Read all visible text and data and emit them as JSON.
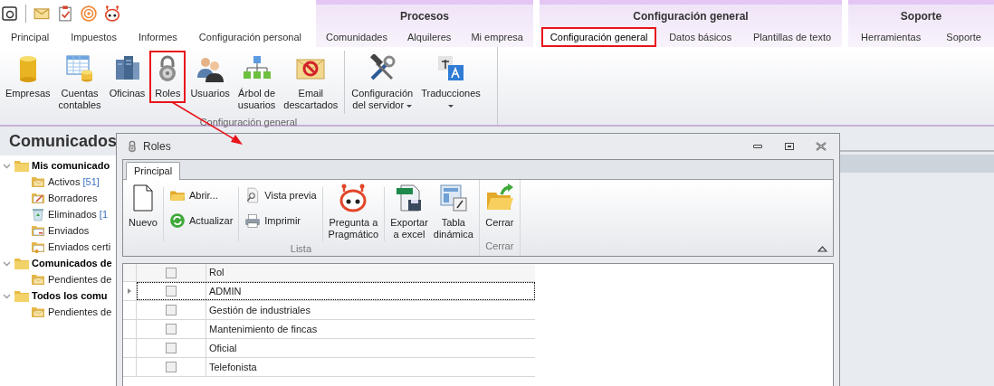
{
  "ribbon": {
    "tabs": [
      {
        "label": "Principal",
        "selected": false,
        "highlighted": false
      },
      {
        "label": "Impuestos",
        "selected": false,
        "highlighted": false
      },
      {
        "label": "Informes",
        "selected": false,
        "highlighted": false
      },
      {
        "label": "Configuración personal",
        "selected": false,
        "highlighted": false
      }
    ],
    "tab_groups": [
      {
        "title": "Procesos",
        "tabs": [
          {
            "label": "Comunidades",
            "selected": false,
            "highlighted": false
          },
          {
            "label": "Alquileres",
            "selected": false,
            "highlighted": false
          },
          {
            "label": "Mi empresa",
            "selected": false,
            "highlighted": false
          }
        ]
      },
      {
        "title": "Configuración general",
        "tabs": [
          {
            "label": "Configuración general",
            "selected": true,
            "highlighted": true
          },
          {
            "label": "Datos básicos",
            "selected": false,
            "highlighted": false
          },
          {
            "label": "Plantillas de texto",
            "selected": false,
            "highlighted": false
          }
        ]
      },
      {
        "title": "Soporte",
        "tabs": [
          {
            "label": "Herramientas",
            "selected": false,
            "highlighted": false
          },
          {
            "label": "Soporte",
            "selected": false,
            "highlighted": false
          }
        ]
      }
    ],
    "group": {
      "label": "Configuración general",
      "buttons": [
        {
          "label": "Empresas",
          "kind": "database",
          "dropdown": false,
          "highlighted": false
        },
        {
          "label": "Cuentas\ncontables",
          "kind": "ledger",
          "dropdown": false,
          "highlighted": false
        },
        {
          "label": "Oficinas",
          "kind": "servers",
          "dropdown": false,
          "highlighted": false
        },
        {
          "label": "Roles",
          "kind": "lock",
          "dropdown": false,
          "highlighted": true
        },
        {
          "label": "Usuarios",
          "kind": "users",
          "dropdown": false,
          "highlighted": false
        },
        {
          "label": "Árbol de\nusuarios",
          "kind": "tree",
          "dropdown": false,
          "highlighted": false
        },
        {
          "label": "Email\ndescartados",
          "kind": "email",
          "dropdown": false,
          "highlighted": false
        },
        {
          "label": "Configuración\ndel servidor",
          "kind": "tools",
          "dropdown": true,
          "highlighted": false
        },
        {
          "label": "Traducciones",
          "kind": "translate",
          "dropdown": true,
          "highlighted": false
        }
      ]
    }
  },
  "left_pane": {
    "title": "Comunicados",
    "tree": [
      {
        "label": "Mis comunicado",
        "expanded": true,
        "children": [
          {
            "label": "Activos",
            "count": "[51]",
            "kind": "inbox"
          },
          {
            "label": "Borradores",
            "kind": "draft"
          },
          {
            "label": "Eliminados",
            "count": "[1",
            "kind": "bin"
          },
          {
            "label": "Enviados",
            "kind": "sent"
          },
          {
            "label": "Enviados certi",
            "kind": "certified"
          }
        ]
      },
      {
        "label": "Comunicados de",
        "expanded": true,
        "children": [
          {
            "label": "Pendientes de",
            "kind": "inbox"
          }
        ]
      },
      {
        "label": "Todos los comu",
        "expanded": true,
        "children": [
          {
            "label": "Pendientes de",
            "kind": "inbox"
          }
        ]
      }
    ]
  },
  "dialog": {
    "title": "Roles",
    "tabs": [
      {
        "label": "Principal",
        "selected": true
      }
    ],
    "groups": [
      {
        "label": "Lista",
        "columns": [
          {
            "kind": "large",
            "items": [
              {
                "label": "Nuevo",
                "kind": "page"
              }
            ]
          },
          {
            "kind": "small",
            "items": [
              {
                "label": "Abrir...",
                "kind": "folder"
              },
              {
                "label": "Actualizar",
                "kind": "refresh"
              }
            ]
          },
          {
            "kind": "small",
            "items": [
              {
                "label": "Vista previa",
                "kind": "preview"
              },
              {
                "label": "Imprimir",
                "kind": "printer"
              }
            ]
          },
          {
            "kind": "large",
            "items": [
              {
                "label": "Pregunta a\nPragmático",
                "kind": "robot"
              }
            ]
          },
          {
            "kind": "large",
            "items": [
              {
                "label": "Exportar\na excel",
                "kind": "spreadsheet"
              },
              {
                "label": "Tabla\ndinámica",
                "kind": "pivot"
              }
            ]
          }
        ]
      },
      {
        "label": "Cerrar",
        "columns": [
          {
            "kind": "large",
            "items": [
              {
                "label": "Cerrar",
                "kind": "close-folder"
              }
            ]
          }
        ]
      }
    ],
    "grid": {
      "header_checked": false,
      "column": "Rol",
      "rows": [
        {
          "rol": "ADMIN",
          "checked": false,
          "selected": true
        },
        {
          "rol": "Gestión de industriales",
          "checked": false,
          "selected": false
        },
        {
          "rol": "Mantenimiento de fincas",
          "checked": false,
          "selected": false
        },
        {
          "rol": "Oficial",
          "checked": false,
          "selected": false
        },
        {
          "rol": "Telefonista",
          "checked": false,
          "selected": false
        }
      ]
    }
  }
}
